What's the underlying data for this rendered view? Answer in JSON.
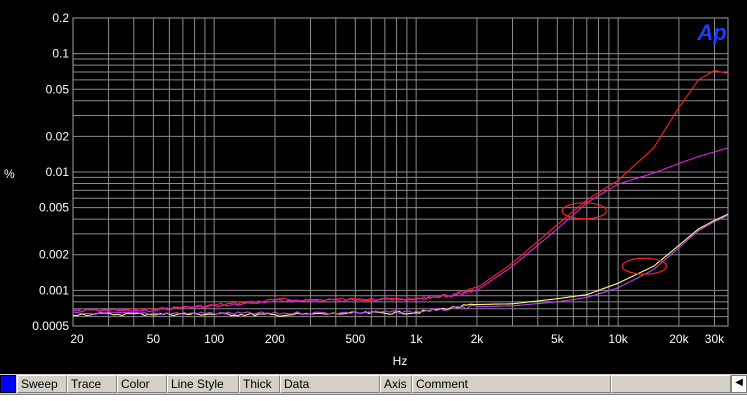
{
  "chart_data": {
    "type": "line",
    "xlabel": "Hz",
    "ylabel": "%",
    "x_scale": "log",
    "y_scale": "log",
    "xlim": [
      20,
      35000
    ],
    "ylim": [
      0.0005,
      0.2
    ],
    "grid": true,
    "x_ticks": [
      {
        "v": 20,
        "label": "20"
      },
      {
        "v": 50,
        "label": "50"
      },
      {
        "v": 100,
        "label": "100"
      },
      {
        "v": 200,
        "label": "200"
      },
      {
        "v": 500,
        "label": "500"
      },
      {
        "v": 1000,
        "label": "1k"
      },
      {
        "v": 2000,
        "label": "2k"
      },
      {
        "v": 5000,
        "label": "5k"
      },
      {
        "v": 10000,
        "label": "10k"
      },
      {
        "v": 20000,
        "label": "20k"
      },
      {
        "v": 30000,
        "label": "30k"
      }
    ],
    "y_ticks": [
      {
        "v": 0.2,
        "label": "0.2"
      },
      {
        "v": 0.1,
        "label": "0.1"
      },
      {
        "v": 0.05,
        "label": "0.05"
      },
      {
        "v": 0.02,
        "label": "0.02"
      },
      {
        "v": 0.01,
        "label": "0.01"
      },
      {
        "v": 0.005,
        "label": "0.005"
      },
      {
        "v": 0.002,
        "label": "0.002"
      },
      {
        "v": 0.001,
        "label": "0.001"
      },
      {
        "v": 0.0005,
        "label": "0.0005"
      }
    ],
    "series": [
      {
        "color": "#ff2020",
        "x": [
          20,
          50,
          100,
          200,
          500,
          1000,
          1500,
          2000,
          3000,
          5000,
          7000,
          10000,
          15000,
          20000,
          25000,
          30000,
          35000
        ],
        "y": [
          0.00068,
          0.00069,
          0.00075,
          0.00083,
          0.00084,
          0.00085,
          0.00091,
          0.00105,
          0.0017,
          0.0036,
          0.0058,
          0.0085,
          0.016,
          0.035,
          0.06,
          0.072,
          0.068
        ]
      },
      {
        "color": "#e020e0",
        "x": [
          20,
          50,
          100,
          200,
          500,
          1000,
          1500,
          2000,
          3000,
          5000,
          7000,
          10000,
          15000,
          20000,
          25000,
          30000,
          35000
        ],
        "y": [
          0.00067,
          0.00068,
          0.00074,
          0.00082,
          0.00083,
          0.00084,
          0.0009,
          0.001,
          0.0016,
          0.0033,
          0.0055,
          0.0079,
          0.0098,
          0.0118,
          0.0135,
          0.0148,
          0.016
        ]
      },
      {
        "color": "#ffff80",
        "x": [
          20,
          50,
          100,
          200,
          500,
          1000,
          2000,
          3000,
          5000,
          7000,
          10000,
          15000,
          20000,
          25000,
          30000,
          35000
        ],
        "y": [
          0.00063,
          0.00063,
          0.00063,
          0.00062,
          0.00064,
          0.00065,
          0.00076,
          0.00077,
          0.00085,
          0.00092,
          0.00115,
          0.0016,
          0.0024,
          0.0033,
          0.0039,
          0.0044
        ]
      },
      {
        "color": "#c040ff",
        "x": [
          20,
          50,
          100,
          200,
          500,
          1000,
          2000,
          3000,
          5000,
          7000,
          10000,
          15000,
          20000,
          25000,
          30000,
          35000
        ],
        "y": [
          0.00064,
          0.00064,
          0.00064,
          0.00064,
          0.00065,
          0.00066,
          0.00073,
          0.00074,
          0.0008,
          0.00087,
          0.00105,
          0.0015,
          0.0023,
          0.0032,
          0.0038,
          0.0043
        ]
      }
    ],
    "annotations": [
      {
        "shape": "ellipse",
        "cx": 6800,
        "cy": 0.0047,
        "color": "#ff2020"
      },
      {
        "shape": "ellipse",
        "cx": 13500,
        "cy": 0.0016,
        "color": "#ff2020"
      }
    ]
  },
  "logo": {
    "text": "Ap",
    "color": "#1a3cff"
  },
  "legend": {
    "columns": [
      "Sweep",
      "Trace",
      "Color",
      "Line Style",
      "Thick",
      "Data",
      "Axis",
      "Comment"
    ],
    "scroll_glyph": "◀"
  }
}
